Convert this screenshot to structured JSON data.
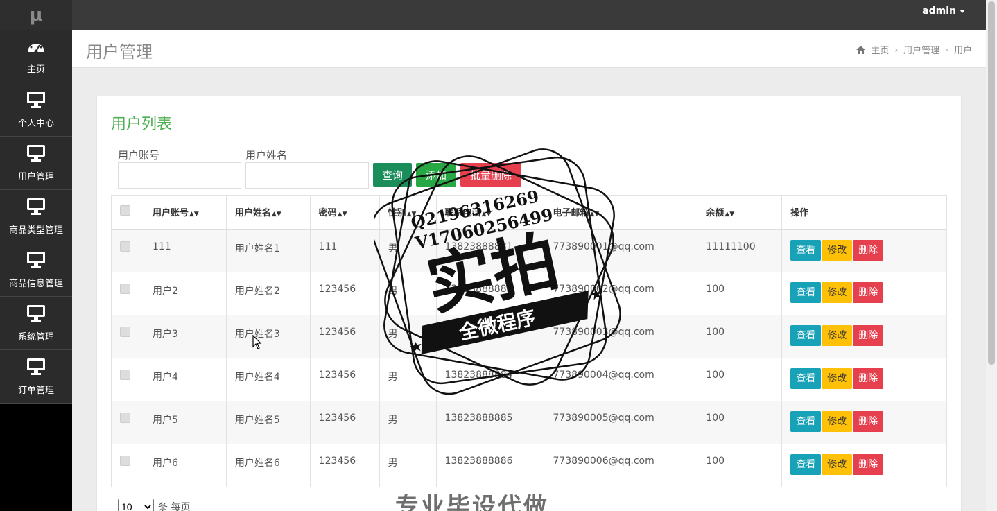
{
  "logo": "μ",
  "sidebar": {
    "items": [
      {
        "label": "主页",
        "icon": "dashboard-icon"
      },
      {
        "label": "个人中心",
        "icon": "monitor-icon"
      },
      {
        "label": "用户管理",
        "icon": "monitor-icon"
      },
      {
        "label": "商品类型管理",
        "icon": "monitor-icon"
      },
      {
        "label": "商品信息管理",
        "icon": "monitor-icon"
      },
      {
        "label": "系统管理",
        "icon": "monitor-icon"
      },
      {
        "label": "订单管理",
        "icon": "monitor-icon"
      }
    ]
  },
  "topbar": {
    "user": "admin"
  },
  "header": {
    "title": "用户管理",
    "breadcrumb": [
      "主页",
      "用户管理",
      "用户"
    ]
  },
  "card": {
    "title": "用户列表"
  },
  "search": {
    "account_label": "用户账号",
    "name_label": "用户姓名",
    "account_value": "",
    "name_value": ""
  },
  "buttons": {
    "query": "查询",
    "add": "添加",
    "bulk_delete": "批量删除"
  },
  "table": {
    "headers": [
      "用户账号",
      "用户姓名",
      "密码",
      "性别",
      "联系电话",
      "电子邮箱",
      "余额",
      "操作"
    ],
    "rows": [
      {
        "account": "111",
        "name": "用户姓名1",
        "password": "111",
        "gender": "男",
        "phone": "13823888881",
        "email": "773890001@qq.com",
        "balance": "11111100"
      },
      {
        "account": "用户2",
        "name": "用户姓名2",
        "password": "123456",
        "gender": "男",
        "phone": "13823888882",
        "email": "773890002@qq.com",
        "balance": "100"
      },
      {
        "account": "用户3",
        "name": "用户姓名3",
        "password": "123456",
        "gender": "男",
        "phone": "13823888883",
        "email": "773890003@qq.com",
        "balance": "100"
      },
      {
        "account": "用户4",
        "name": "用户姓名4",
        "password": "123456",
        "gender": "男",
        "phone": "13823888884",
        "email": "773890004@qq.com",
        "balance": "100"
      },
      {
        "account": "用户5",
        "name": "用户姓名5",
        "password": "123456",
        "gender": "男",
        "phone": "13823888885",
        "email": "773890005@qq.com",
        "balance": "100"
      },
      {
        "account": "用户6",
        "name": "用户姓名6",
        "password": "123456",
        "gender": "男",
        "phone": "13823888886",
        "email": "773890006@qq.com",
        "balance": "100"
      }
    ],
    "actions": {
      "view": "查看",
      "edit": "修改",
      "delete": "删除"
    }
  },
  "pager": {
    "page_size": "10",
    "suffix": "条 每页"
  },
  "watermark": {
    "qq": "Q2196316269",
    "wechat": "V17060256499",
    "main": "实拍",
    "banner": "全微程序",
    "bottom": "专业毕设代做"
  },
  "colors": {
    "accent_green": "#4caf50",
    "view": "#17a2b8",
    "edit": "#ffc107",
    "delete": "#e6404f"
  }
}
